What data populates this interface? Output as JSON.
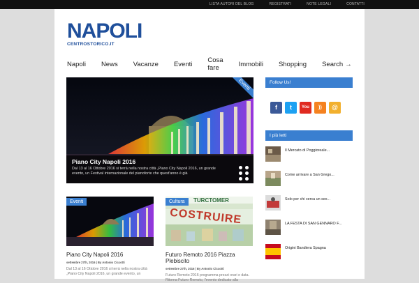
{
  "topbar": {
    "links": [
      "LISTA AUTORI DEL BLOG",
      "REGISTRATI",
      "NOTE LEGALI",
      "CONTATTI"
    ]
  },
  "logo": {
    "main": "NAPOLI",
    "sub_prefix": "CENTRO",
    "sub_storico": "STORICO",
    "sub_suffix": ".IT"
  },
  "nav": {
    "items": [
      "Napoli",
      "News",
      "Vacanze",
      "Eventi",
      "Cosa fare",
      "Immobili",
      "Shopping"
    ],
    "search": "Search",
    "search_arrow": "→"
  },
  "featured": {
    "badge": "Eventi",
    "title": "Piano City Napoli 2016",
    "excerpt": "Dal 13 al 16 Ottobre 2016 si terrà nella nostra città „Piano City Napoli 2016, un grande evento, un Festival internazionale del pianoforte che quest'anno è già"
  },
  "cards": [
    {
      "badge": "Eventi",
      "title": "Piano City Napoli 2016",
      "meta": "settembre 27th, 2016 | By Antonio Ciccotti",
      "excerpt": "Dal 13 al 16 Ottobre 2016 si terrà nella nostra città „Piano City Napoli 2016, un grande evento, un"
    },
    {
      "badge": "Cultura",
      "overlay_word": "TURCTOMER",
      "thumb_word": "COSTRUIRE",
      "title": "Futuro Remoto 2016 Piazza Plebiscito",
      "meta": "settembre 27th, 2016 | By Antonio Ciccotti",
      "excerpt": "Futuro Remoto 2016 programma prezzi orari e data. Ritorna Futuro Remoto, l'evento dedicato alla"
    }
  ],
  "sidebar": {
    "follow_title": "Follow Us!",
    "social": [
      "facebook-icon",
      "twitter-icon",
      "youtube-icon",
      "rss-icon",
      "email-icon"
    ],
    "social_labels": {
      "facebook": "f",
      "twitter": "t",
      "youtube": "You",
      "rss": "))",
      "email": "@"
    },
    "popular_title": "I più letti",
    "popular": [
      "Il Mercato di Poggioreale...",
      "Come arrivare a San Grego...",
      "Solo per chi cerca un sex...",
      "LA FESTA DI SAN GENNARO F...",
      "Origini Bandiera Spagna"
    ]
  },
  "colors": {
    "accent": "#3a7fd0",
    "logo": "#1f4f9b",
    "topbar": "#111111"
  }
}
